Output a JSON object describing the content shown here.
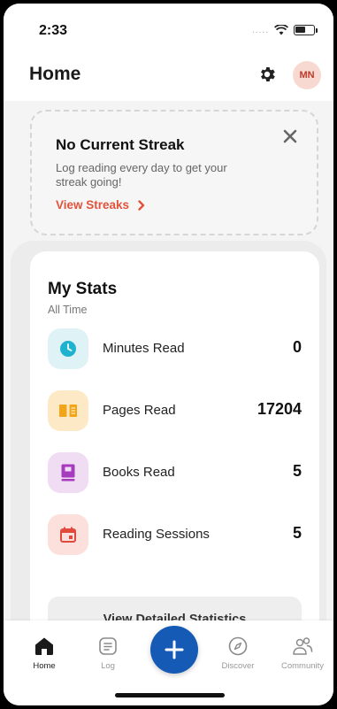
{
  "status_bar": {
    "time": "2:33",
    "signal_dots": "....."
  },
  "header": {
    "title": "Home",
    "avatar_initials": "MN"
  },
  "streak_card": {
    "title": "No Current Streak",
    "text": "Log reading every day to get your streak going!",
    "link_label": "View Streaks"
  },
  "stats": {
    "title": "My Stats",
    "subtitle": "All Time",
    "rows": [
      {
        "label": "Minutes Read",
        "value": "0",
        "icon": "clock-icon",
        "bg": "#dff3f7",
        "fg": "#1fb2cf"
      },
      {
        "label": "Pages Read",
        "value": "17204",
        "icon": "book-open-icon",
        "bg": "#fde9c6",
        "fg": "#f2a516"
      },
      {
        "label": "Books Read",
        "value": "5",
        "icon": "book-icon",
        "bg": "#f0dcf3",
        "fg": "#a63cbd"
      },
      {
        "label": "Reading Sessions",
        "value": "5",
        "icon": "calendar-icon",
        "bg": "#fbe0dc",
        "fg": "#e24a3b"
      }
    ],
    "detail_button": "View Detailed Statistics"
  },
  "nav": {
    "items": [
      {
        "label": "Home",
        "icon": "home-icon",
        "active": true
      },
      {
        "label": "Log",
        "icon": "log-icon",
        "active": false
      },
      {
        "label": "Discover",
        "icon": "compass-icon",
        "active": false
      },
      {
        "label": "Community",
        "icon": "community-icon",
        "active": false
      }
    ],
    "fab_icon": "plus-icon"
  },
  "colors": {
    "accent": "#e0533c",
    "fab": "#155bb5",
    "avatar_bg": "#f8d9d2"
  }
}
